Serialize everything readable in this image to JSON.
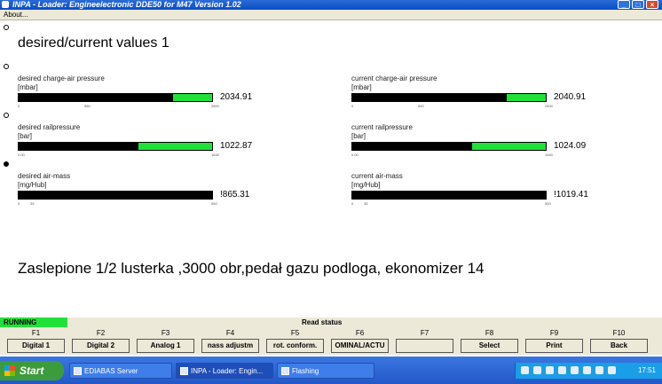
{
  "window": {
    "title": "INPA - Loader:  Engineelectronic DDE50 for M47 Version 1.02",
    "buttons": [
      "_",
      "□",
      "×"
    ]
  },
  "menu": {
    "about": "About..."
  },
  "page": {
    "title": "desired/current values 1"
  },
  "gauges": [
    {
      "label": "desired charge-air pressure",
      "unit": "[mbar]",
      "value": "2034.91",
      "fraction": 0.8,
      "ticks": [
        "0",
        "550",
        "2500"
      ]
    },
    {
      "label": "current charge-air pressure",
      "unit": "[mbar]",
      "value": "2040.91",
      "fraction": 0.8,
      "ticks": [
        "0",
        "550",
        "2500"
      ]
    },
    {
      "label": "desired railpressure",
      "unit": "[bar]",
      "value": "1022.87",
      "fraction": 0.62,
      "ticks": [
        "0.00",
        "1640"
      ]
    },
    {
      "label": "current railpressure",
      "unit": "[bar]",
      "value": "1024.09",
      "fraction": 0.62,
      "ticks": [
        "0.00",
        "1640"
      ]
    },
    {
      "label": "desired air-mass",
      "unit": "[mg/Hub]",
      "value": "!865.31",
      "fraction": 1.0,
      "ticks": [
        "0",
        "35",
        "550"
      ]
    },
    {
      "label": "current air-mass",
      "unit": "[mg/Hub]",
      "value": "!1019.41",
      "fraction": 1.0,
      "ticks": [
        "0",
        "35",
        "550"
      ]
    }
  ],
  "comment": "Zaslepione 1/2 lusterka ,3000 obr,pedał gazu podloga, ekonomizer 14",
  "status": {
    "running": "RUNNING",
    "read": "Read status"
  },
  "fkeys": [
    {
      "key": "F1",
      "label": "Digital 1"
    },
    {
      "key": "F2",
      "label": "Digital 2"
    },
    {
      "key": "F3",
      "label": "Analog 1"
    },
    {
      "key": "F4",
      "label": "nass adjustm"
    },
    {
      "key": "F5",
      "label": "rot. conform."
    },
    {
      "key": "F6",
      "label": "OMINAL/ACTU"
    },
    {
      "key": "F7",
      "label": ""
    },
    {
      "key": "F8",
      "label": "Select"
    },
    {
      "key": "F9",
      "label": "Print"
    },
    {
      "key": "F10",
      "label": "Back"
    }
  ],
  "taskbar": {
    "start": "Start",
    "tasks": [
      "EDIABAS Server",
      "INPA - Loader:  Engin...",
      "Flashing"
    ],
    "clock": "17:51"
  },
  "colors": {
    "bar_green": "#22e03a",
    "bar_red": "#a51414",
    "taskbar": "#2458c9"
  }
}
